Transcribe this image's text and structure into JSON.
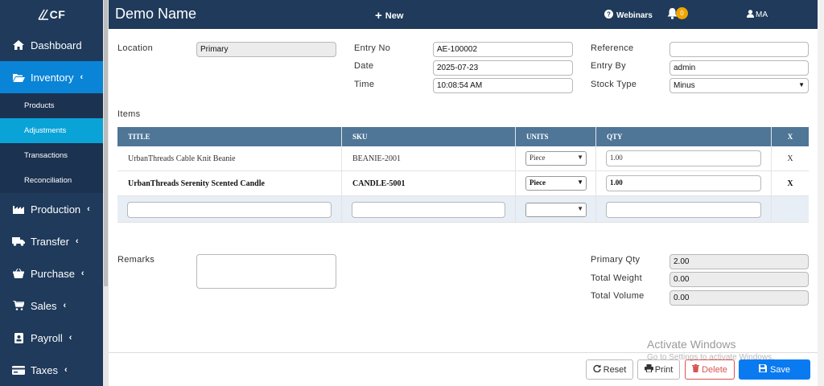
{
  "app": {
    "logo_text": "CF",
    "page_title": "Demo Name",
    "new_label": "New",
    "webinars_label": "Webinars",
    "notification_count": "0",
    "user_initials": "MA"
  },
  "sidebar": {
    "items": [
      {
        "label": "Dashboard",
        "icon": "home-icon"
      },
      {
        "label": "Inventory",
        "icon": "folder-open-icon",
        "active": true
      },
      {
        "label": "Production",
        "icon": "factory-icon"
      },
      {
        "label": "Transfer",
        "icon": "truck-icon"
      },
      {
        "label": "Purchase",
        "icon": "basket-icon"
      },
      {
        "label": "Sales",
        "icon": "cart-icon"
      },
      {
        "label": "Payroll",
        "icon": "id-card-icon"
      },
      {
        "label": "Taxes",
        "icon": "credit-card-icon"
      }
    ],
    "sub_items": [
      {
        "label": "Products"
      },
      {
        "label": "Adjustments",
        "active": true
      },
      {
        "label": "Transactions"
      },
      {
        "label": "Reconciliation"
      }
    ]
  },
  "form": {
    "location_label": "Location",
    "location_value": "Primary",
    "entry_no_label": "Entry No",
    "entry_no_value": "AE-100002",
    "date_label": "Date",
    "date_value": "2025-07-23",
    "time_label": "Time",
    "time_value": "10:08:54 AM",
    "reference_label": "Reference",
    "reference_value": "",
    "entry_by_label": "Entry By",
    "entry_by_value": "admin",
    "stock_type_label": "Stock Type",
    "stock_type_value": "Minus",
    "items_label": "Items"
  },
  "table": {
    "headers": {
      "title": "TITLE",
      "sku": "SKU",
      "units": "UNITS",
      "qty": "QTY",
      "x": "X"
    },
    "rows": [
      {
        "title": "UrbanThreads Cable Knit Beanie",
        "sku": "BEANIE-2001",
        "units": "Piece",
        "qty": "1.00",
        "remove": "X"
      },
      {
        "title": "UrbanThreads Serenity Scented Candle",
        "sku": "CANDLE-5001",
        "units": "Piece",
        "qty": "1.00",
        "remove": "X"
      }
    ]
  },
  "summary": {
    "remarks_label": "Remarks",
    "primary_qty_label": "Primary Qty",
    "primary_qty_value": "2.00",
    "total_weight_label": "Total Weight",
    "total_weight_value": "0.00",
    "total_volume_label": "Total Volume",
    "total_volume_value": "0.00"
  },
  "footer": {
    "reset_label": "Reset",
    "print_label": "Print",
    "delete_label": "Delete",
    "save_label": "Save"
  },
  "watermark": {
    "line1": "Activate Windows",
    "line2": "Go to Settings to activate Windows."
  },
  "colors": {
    "sidebar_bg": "#1f3a5a",
    "active_nav": "#0a84d6",
    "active_sub": "#0aa3d8",
    "table_header": "#4f7597",
    "save_button": "#0a7af0",
    "delete_text": "#d9534f",
    "badge": "#f0a400"
  }
}
